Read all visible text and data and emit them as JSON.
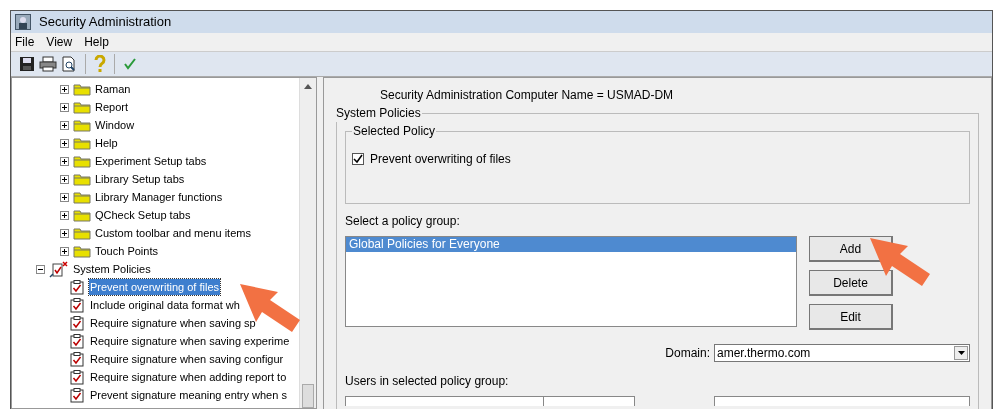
{
  "window": {
    "title": "Security Administration"
  },
  "menu": [
    "File",
    "View",
    "Help"
  ],
  "toolbar": [
    {
      "kind": "save"
    },
    {
      "kind": "print"
    },
    {
      "kind": "preview"
    },
    {
      "kind": "separator"
    },
    {
      "kind": "help"
    },
    {
      "kind": "separator"
    },
    {
      "kind": "apply"
    }
  ],
  "tree": {
    "items": [
      {
        "label": "Raman",
        "kind": "folder",
        "expanded": false
      },
      {
        "label": "Report",
        "kind": "folder",
        "expanded": false
      },
      {
        "label": "Window",
        "kind": "folder",
        "expanded": false
      },
      {
        "label": "Help",
        "kind": "folder",
        "expanded": false
      },
      {
        "label": "Experiment Setup tabs",
        "kind": "folder",
        "expanded": false
      },
      {
        "label": "Library Setup tabs",
        "kind": "folder",
        "expanded": false
      },
      {
        "label": "Library Manager functions",
        "kind": "folder",
        "expanded": false
      },
      {
        "label": "QCheck Setup tabs",
        "kind": "folder",
        "expanded": false
      },
      {
        "label": "Custom toolbar and menu items",
        "kind": "folder",
        "expanded": false
      },
      {
        "label": "Touch Points",
        "kind": "folder",
        "expanded": false
      },
      {
        "label": "System Policies",
        "kind": "policies",
        "expanded": true,
        "children": [
          {
            "label": "Prevent overwriting of files",
            "selected": true
          },
          {
            "label": "Include original data format wh",
            "selected": false
          },
          {
            "label": "Require signature when saving sp",
            "selected": false
          },
          {
            "label": "Require signature when saving experime",
            "selected": false
          },
          {
            "label": "Require signature when saving configur",
            "selected": false
          },
          {
            "label": "Require signature when adding report to",
            "selected": false
          },
          {
            "label": "Prevent signature meaning entry when s",
            "selected": false
          }
        ]
      }
    ]
  },
  "computer_name": "Security Administration Computer Name =  USMAD-DM",
  "system_policies": {
    "title": "System Policies",
    "selected_policy": {
      "title": "Selected Policy",
      "label": "Prevent overwriting of files",
      "checked": true
    },
    "policy_group_label": "Select a policy group:",
    "policy_groups": [
      {
        "label": "Global Policies for Everyone",
        "selected": true
      }
    ],
    "buttons": [
      "Add",
      "Delete",
      "Edit"
    ],
    "domain": {
      "label": "Domain:",
      "value": "amer.thermo.com"
    },
    "users_label": "Users in selected policy group:"
  }
}
